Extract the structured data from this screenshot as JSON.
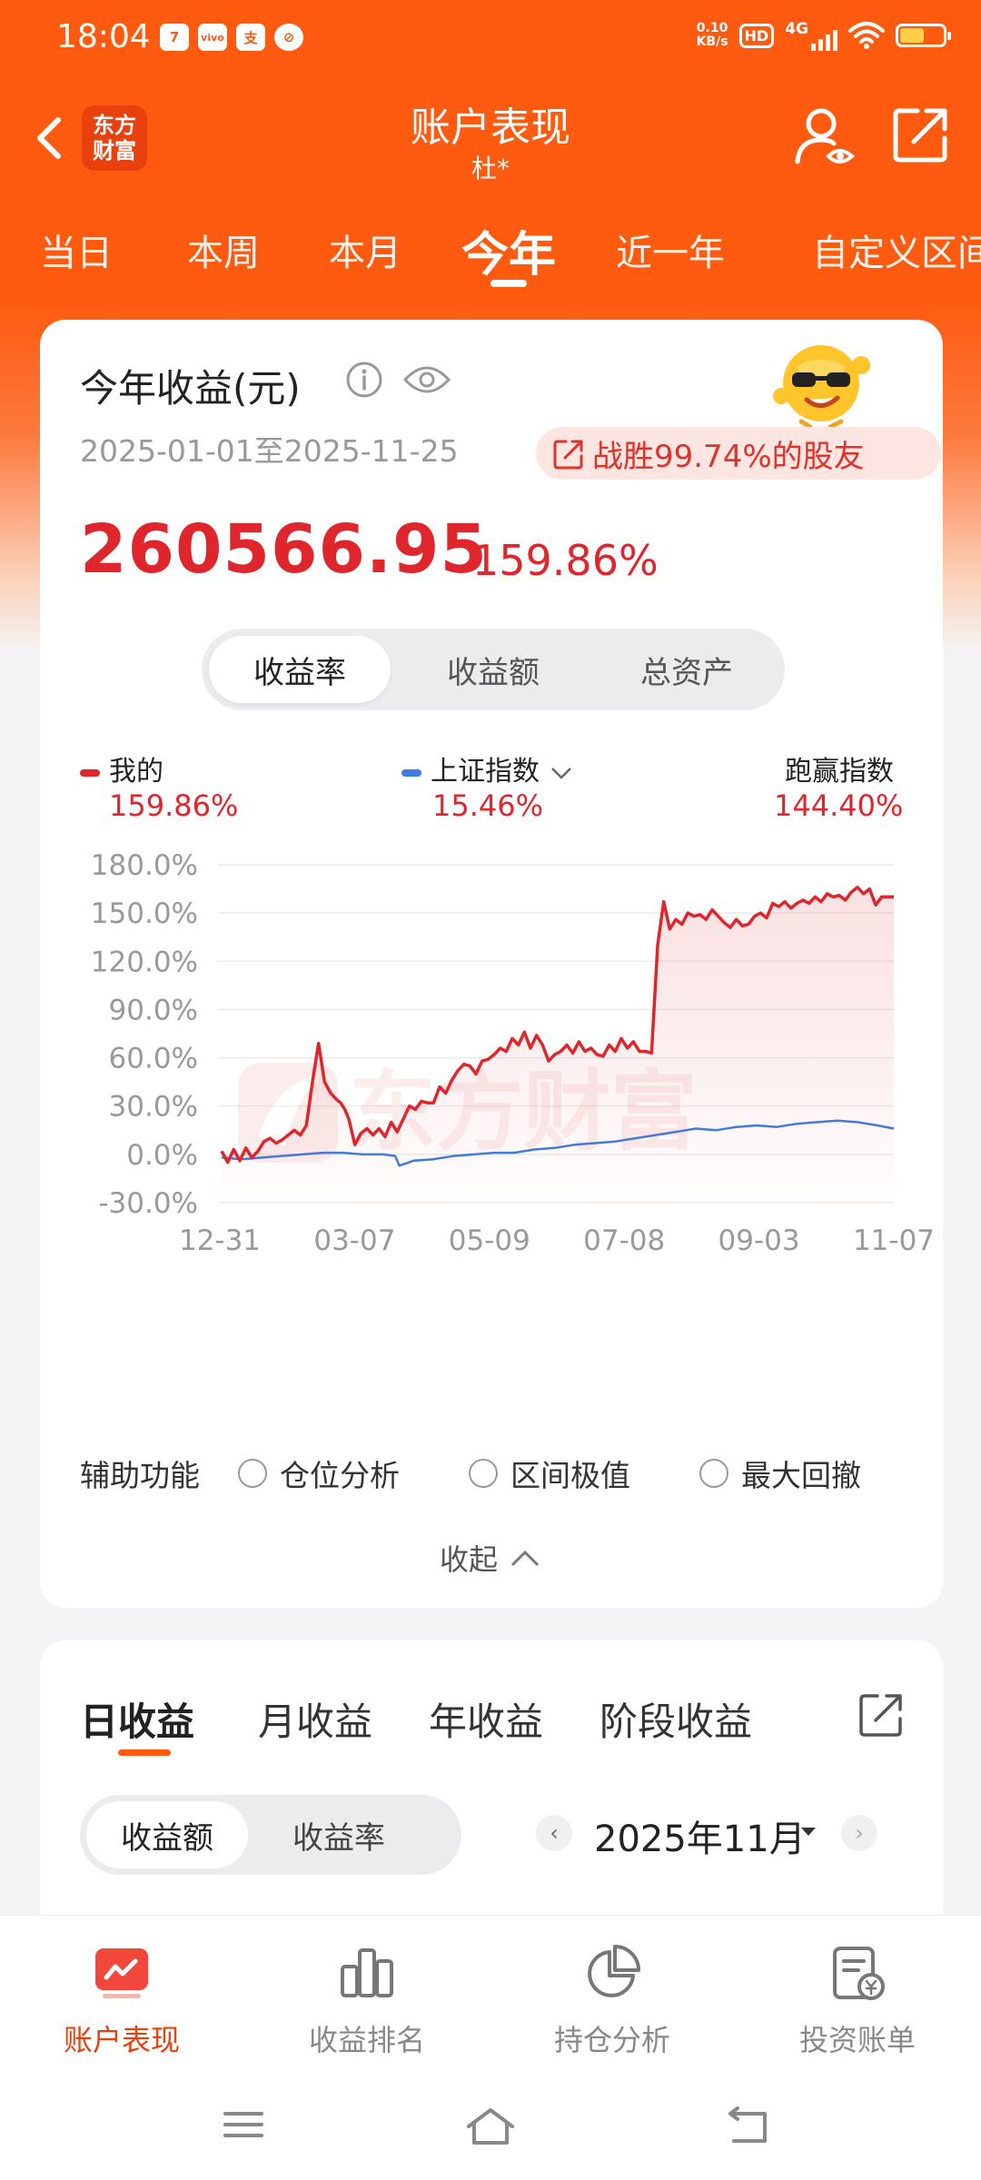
{
  "status_bar": {
    "time": "18:04",
    "apps": [
      "7",
      "vivo",
      "支",
      "⊘"
    ],
    "net_speed": "0.10",
    "net_unit": "KB/s",
    "hd": "HD",
    "network": "4G",
    "battery_level": 0.55
  },
  "header": {
    "logo_text": "东方\n财富",
    "title": "账户表现",
    "subtitle": "杜*"
  },
  "period_tabs": [
    "当日",
    "本周",
    "本月",
    "今年",
    "近一年",
    "自定义区间"
  ],
  "period_active_index": 3,
  "summary": {
    "title": "今年收益(元)",
    "date_range": "2025-01-01至2025-11-25",
    "beat_text": "战胜99.74%的股友",
    "amount": "260566.95",
    "percent": "159.86%"
  },
  "metric_tabs": [
    "收益率",
    "收益额",
    "总资产"
  ],
  "legend": {
    "mine_label": "我的",
    "mine_value": "159.86%",
    "index_label": "上证指数",
    "index_value": "15.46%",
    "outperform_label": "跑赢指数",
    "outperform_value": "144.40%",
    "watermark": "东方财富"
  },
  "chart_data": {
    "type": "line",
    "x_tick_labels": [
      "12-31",
      "03-07",
      "05-09",
      "07-08",
      "09-03",
      "11-07"
    ],
    "y_tick_labels": [
      "180.0%",
      "150.0%",
      "120.0%",
      "90.0%",
      "60.0%",
      "30.0%",
      "0.0%",
      "-30.0%"
    ],
    "ylim": [
      -30,
      180
    ],
    "grid": true,
    "series": [
      {
        "name": "我的",
        "color": "#e0262d",
        "x": [
          0,
          3,
          6,
          9,
          12,
          15,
          18,
          21,
          24,
          27,
          30,
          33,
          36,
          39,
          42,
          45,
          48,
          51,
          54,
          57,
          59,
          61,
          63,
          66,
          69,
          72,
          75,
          78,
          81,
          84,
          87,
          90,
          93,
          96,
          99,
          102,
          105,
          108,
          111,
          114,
          117,
          120,
          123,
          126,
          129,
          132,
          135,
          138,
          141,
          144,
          147,
          150,
          153,
          156,
          159,
          162,
          165,
          168,
          171,
          174,
          177,
          180,
          183,
          186,
          189,
          192,
          195,
          198,
          201,
          204,
          207,
          210,
          213,
          216,
          219,
          222,
          225,
          228,
          231,
          234,
          237,
          240,
          243,
          246,
          249,
          252,
          255,
          258,
          261,
          264,
          267,
          270,
          273,
          276,
          279,
          282,
          285,
          288,
          291,
          294,
          297,
          300,
          303,
          306,
          309,
          312,
          315,
          318,
          321,
          324,
          327,
          330,
          333
        ],
        "values": [
          2,
          -5,
          3,
          -4,
          4,
          -2,
          2,
          8,
          10,
          7,
          9,
          12,
          15,
          12,
          18,
          45,
          69,
          45,
          38,
          34,
          32,
          28,
          22,
          6,
          13,
          16,
          12,
          16,
          11,
          20,
          14,
          22,
          30,
          28,
          33,
          32,
          32,
          42,
          38,
          46,
          52,
          56,
          55,
          50,
          58,
          59,
          62,
          66,
          64,
          72,
          68,
          76,
          66,
          74,
          68,
          58,
          62,
          64,
          68,
          63,
          70,
          64,
          66,
          62,
          61,
          68,
          64,
          72,
          66,
          70,
          64,
          64,
          63,
          130,
          157,
          140,
          146,
          143,
          150,
          148,
          149,
          146,
          152,
          148,
          144,
          141,
          146,
          142,
          143,
          148,
          150,
          147,
          156,
          154,
          157,
          153,
          156,
          158,
          156,
          160,
          157,
          162,
          160,
          161,
          158,
          163,
          166,
          162,
          165,
          155,
          160,
          160,
          160
        ],
        "x_domain": [
          0,
          333
        ]
      },
      {
        "name": "上证指数",
        "color": "#3f7de0",
        "x": [
          0,
          10,
          20,
          30,
          40,
          50,
          60,
          70,
          80,
          86,
          88,
          95,
          105,
          115,
          125,
          135,
          145,
          155,
          165,
          175,
          185,
          195,
          205,
          215,
          225,
          235,
          245,
          255,
          265,
          275,
          285,
          295,
          305,
          315,
          325,
          333
        ],
        "values": [
          -2,
          -3,
          -2,
          -1,
          0,
          1,
          1,
          0,
          0,
          -1,
          -7,
          -4,
          -3,
          -1,
          0,
          1,
          1,
          3,
          4,
          6,
          7,
          8,
          10,
          12,
          14,
          16,
          15,
          17,
          18,
          17,
          19,
          20,
          21,
          20,
          18,
          16
        ],
        "x_domain": [
          0,
          333
        ]
      }
    ]
  },
  "aux": {
    "label": "辅助功能",
    "options": [
      "仓位分析",
      "区间极值",
      "最大回撤"
    ]
  },
  "collapse_label": "收起",
  "daily": {
    "tabs": [
      "日收益",
      "月收益",
      "年收益",
      "阶段收益"
    ],
    "active_index": 0,
    "sub_tabs": [
      "收益额",
      "收益率"
    ],
    "month": "2025年11月"
  },
  "bottom_nav": [
    {
      "label": "账户表现",
      "icon": "chart-card-icon",
      "active": true
    },
    {
      "label": "收益排名",
      "icon": "bar-ranking-icon",
      "active": false
    },
    {
      "label": "持仓分析",
      "icon": "pie-chart-icon",
      "active": false
    },
    {
      "label": "投资账单",
      "icon": "bill-icon",
      "active": false
    }
  ],
  "colors": {
    "brand": "#fe5a10",
    "gain": "#e0262d",
    "index_line": "#3f7de0"
  }
}
